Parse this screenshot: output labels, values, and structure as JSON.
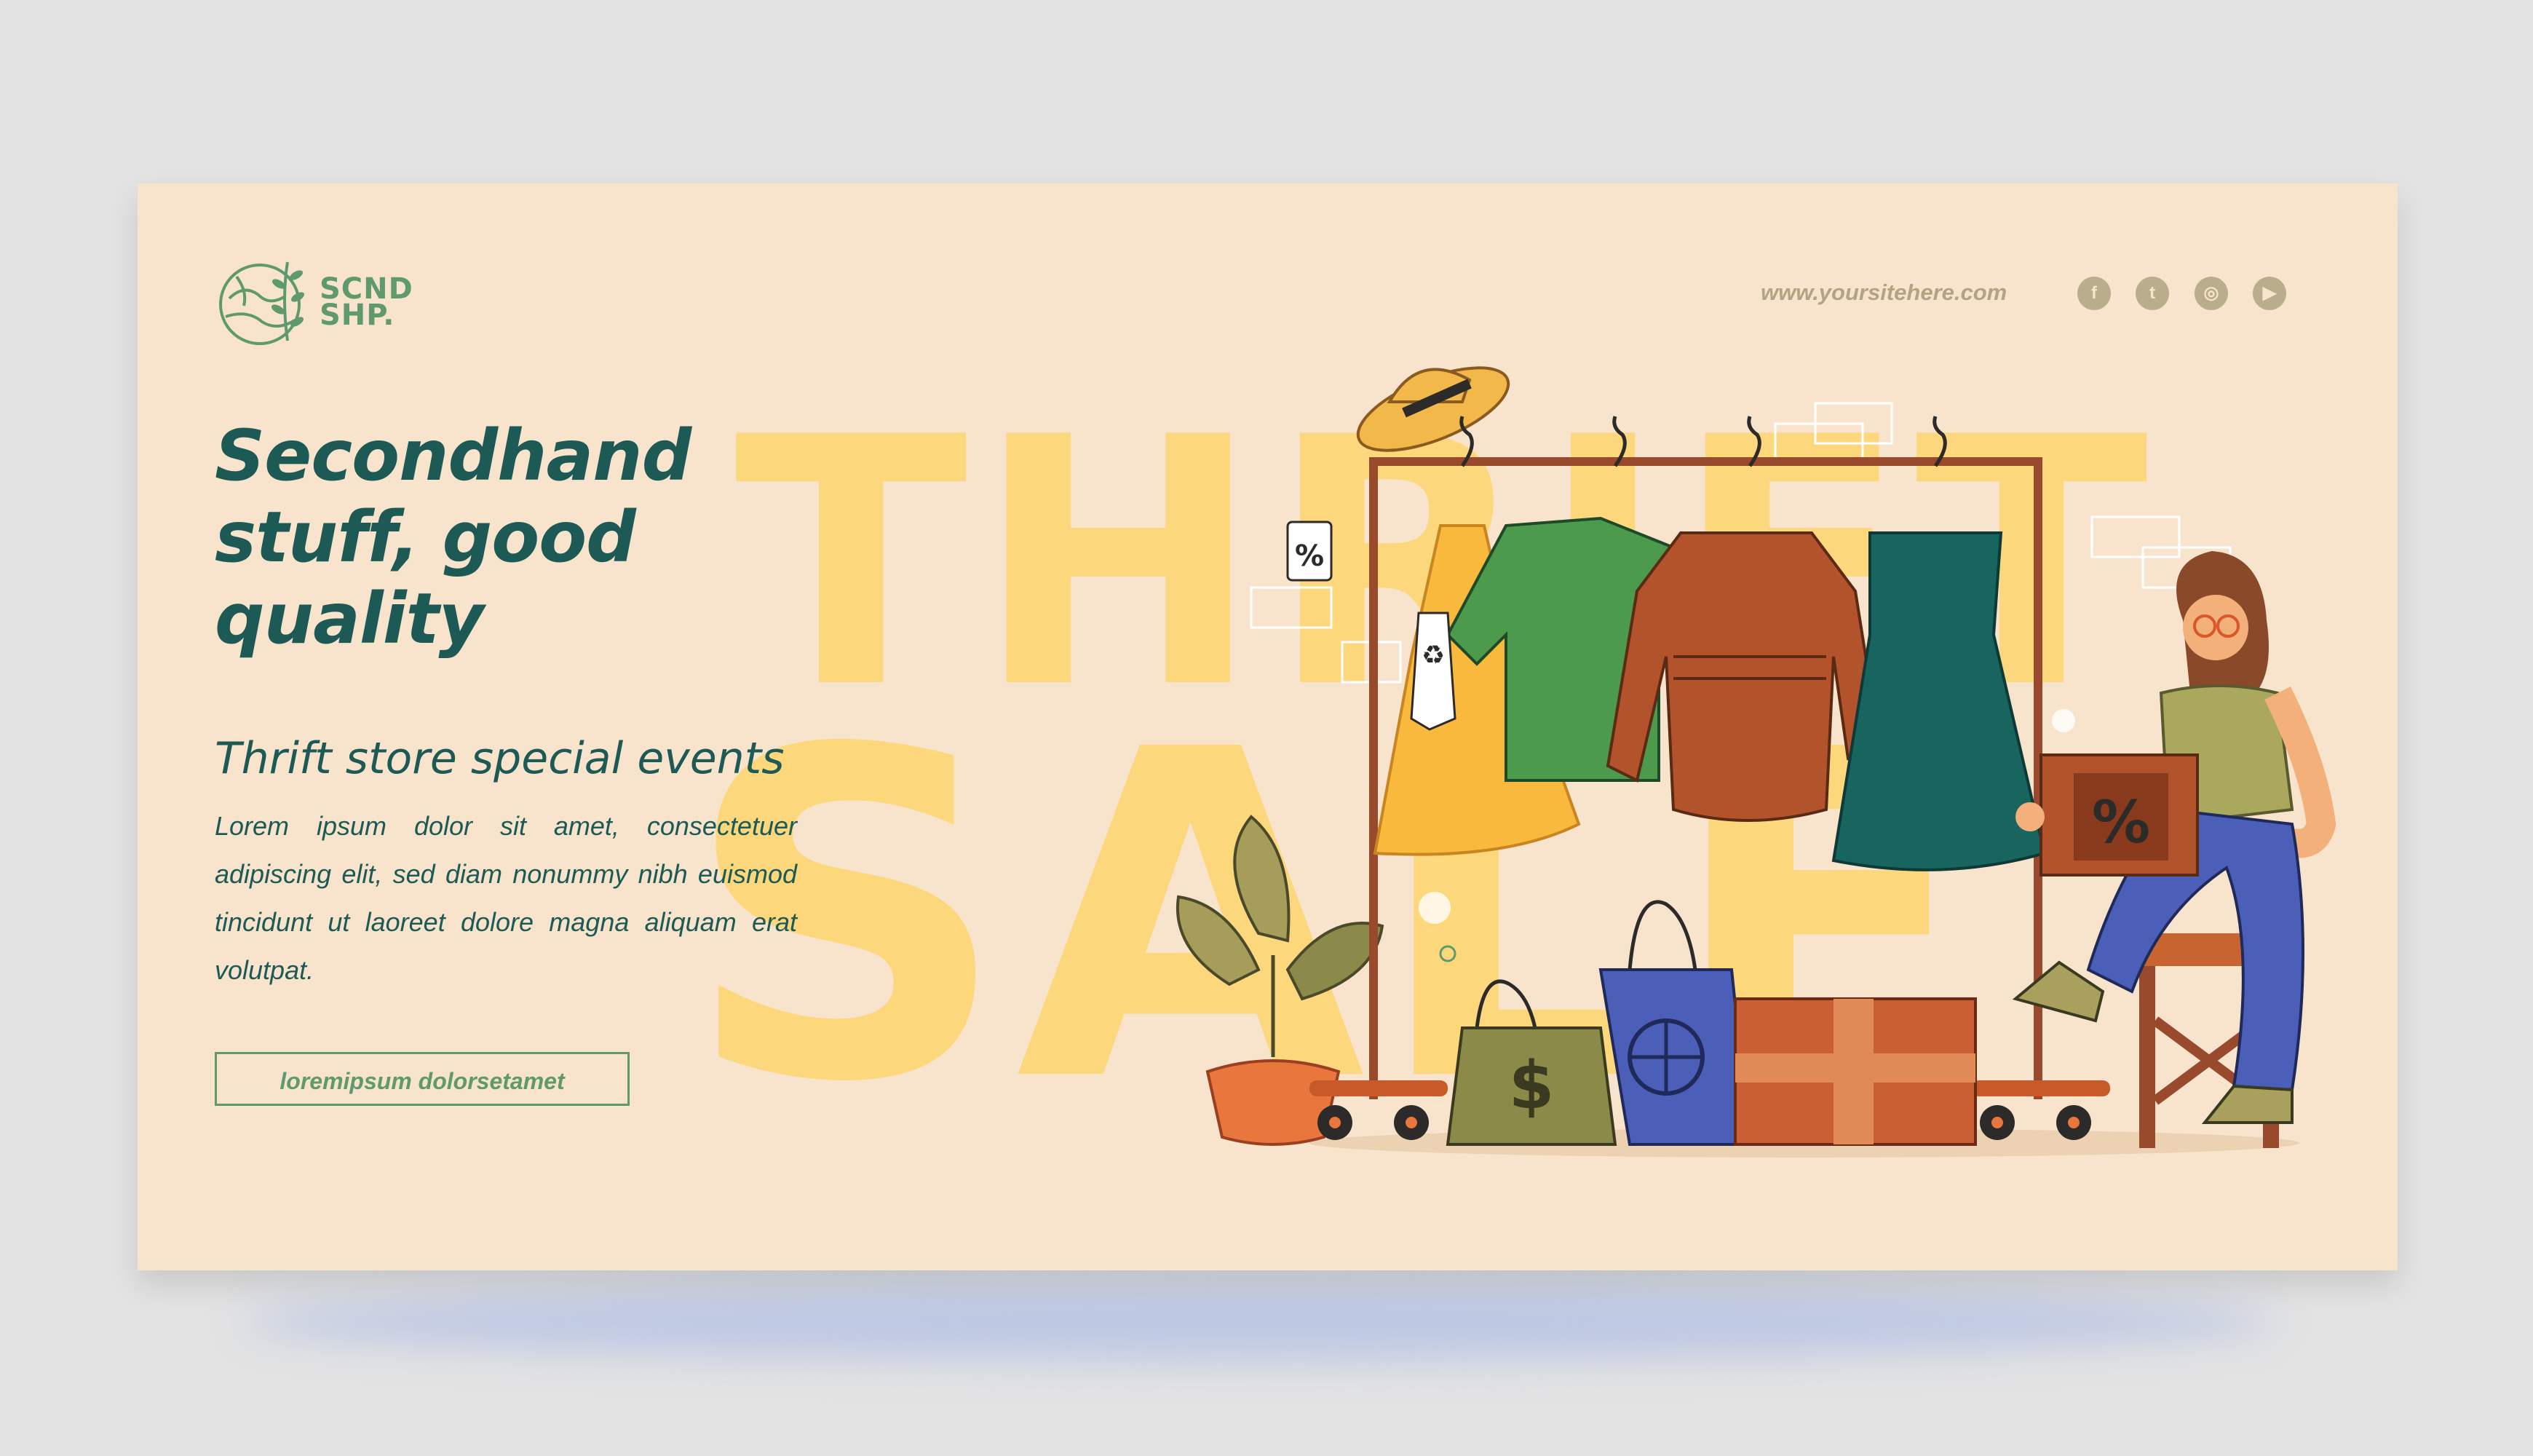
{
  "brand": {
    "line1": "SCND",
    "line2": "SHP."
  },
  "header": {
    "url": "www.yoursitehere.com",
    "social": [
      "facebook-icon",
      "twitter-icon",
      "instagram-icon",
      "youtube-icon"
    ],
    "social_glyphs": [
      "f",
      "t",
      "◎",
      "▶"
    ]
  },
  "hero": {
    "headline_1": "Secondhand",
    "headline_2": "stuff, good",
    "headline_3": "quality",
    "subheadline": "Thrift store special events",
    "body": "Lorem ipsum dolor sit amet, consectetuer adipiscing elit, sed diam nonummy nibh euismod tincidunt ut laoreet dolore magna aliquam erat volutpat.",
    "cta": "loremipsum dolorsetamet"
  },
  "background_words": {
    "top": "THRIFT",
    "bottom": "SALE"
  },
  "tags": {
    "percent": "%",
    "box_percent": "%",
    "bag_dollar": "$"
  },
  "colors": {
    "background": "#f8e4cc",
    "brand_green": "#5f9a6c",
    "heading_teal": "#1d5a55",
    "bg_word_yellow": "#fcd77b"
  }
}
